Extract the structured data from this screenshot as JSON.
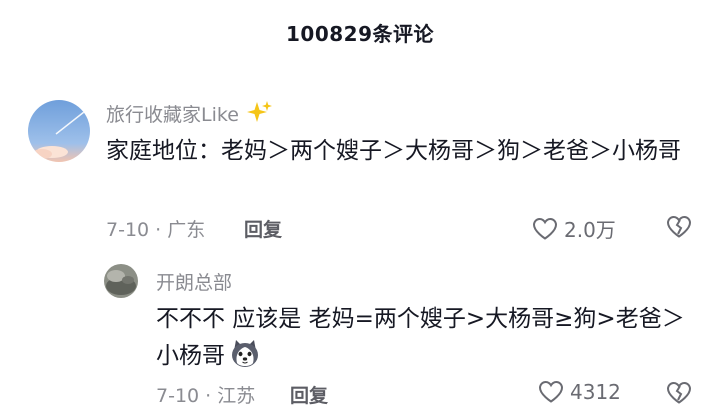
{
  "header": {
    "title": "100829条评论"
  },
  "comments": [
    {
      "username": "旅行收藏家Like",
      "username_emoji": "sparkles-icon",
      "text": "家庭地位：老妈＞两个嫂子＞大杨哥＞狗＞老爸＞小杨哥",
      "meta": "7-10 · 广东",
      "reply_label": "回复",
      "likes": "2.0万"
    },
    {
      "username": "开朗总部",
      "text": "不不不  应该是  老妈=两个嫂子>大杨哥≥狗>老爸＞小杨哥",
      "text_emoji": "husky-dog-emoji-icon",
      "meta": "7-10 · 江苏",
      "reply_label": "回复",
      "likes": "4312"
    }
  ],
  "colors": {
    "text": "#161823",
    "secondary": "#8a8b91",
    "background": "#ffffff"
  }
}
